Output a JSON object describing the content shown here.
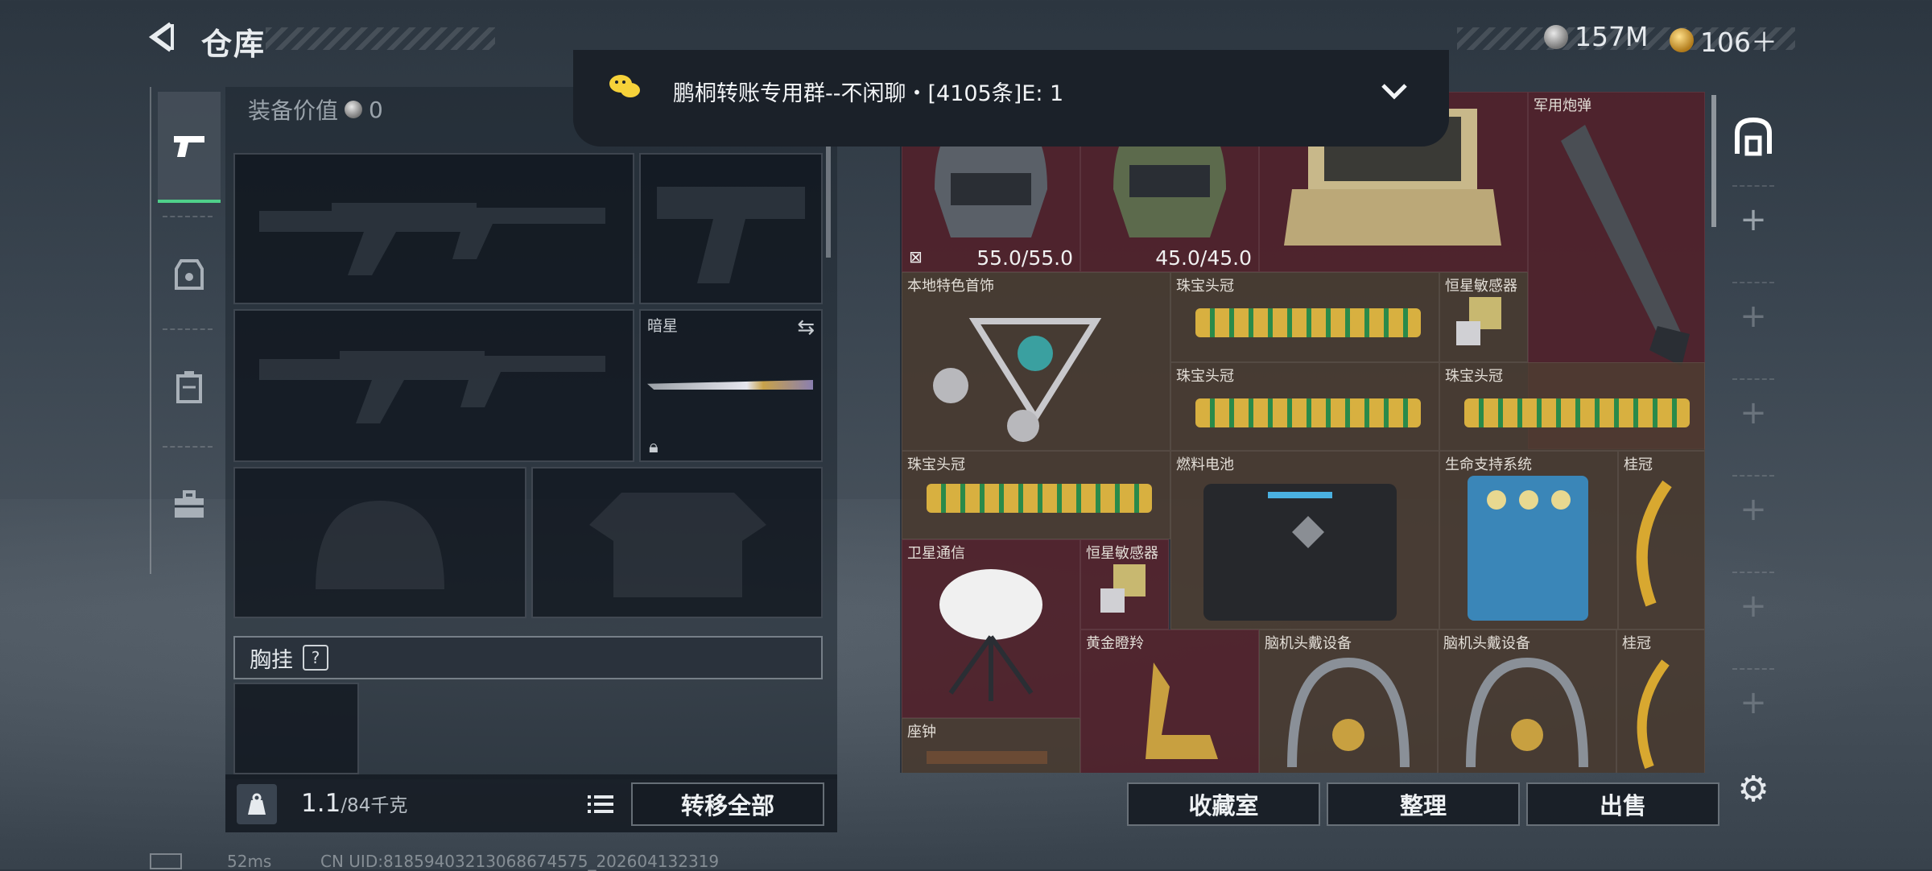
{
  "header": {
    "title": "仓库",
    "currency_silver": "157M",
    "currency_gold": "106＋"
  },
  "notification": {
    "text": "鹏桐转账专用群--不闲聊・[4105条]E: 1",
    "app_icon": "wechat-icon",
    "chevron": "chevron-down-icon"
  },
  "equipment": {
    "value_label": "装备价值",
    "value": "0",
    "melee_name": "暗星",
    "chest_label": "胸挂",
    "chest_help": "?"
  },
  "weight": {
    "current": "1.1",
    "max": "/84千克"
  },
  "buttons": {
    "transfer_all": "转移全部",
    "collection": "收藏室",
    "organize": "整理",
    "sell": "出售"
  },
  "stash": {
    "helmet1_durability": "55.0/55.0",
    "helmet2_durability": "45.0/45.0",
    "cells": [
      {
        "name": "军用炮弹"
      },
      {
        "name": "本地特色首饰"
      },
      {
        "name": "珠宝头冠"
      },
      {
        "name": "恒星敏感器"
      },
      {
        "name": "珠宝头冠"
      },
      {
        "name": "珠宝头冠"
      },
      {
        "name": "珠宝头冠"
      },
      {
        "name": "燃料电池"
      },
      {
        "name": "生命支持系统"
      },
      {
        "name": "桂冠"
      },
      {
        "name": "卫星通信"
      },
      {
        "name": "恒星敏感器"
      },
      {
        "name": "黄金瞪羚"
      },
      {
        "name": "脑机头戴设备"
      },
      {
        "name": "脑机头戴设备"
      },
      {
        "name": "桂冠"
      },
      {
        "name": "座钟"
      }
    ]
  },
  "footer": {
    "ping": "52ms",
    "uid": "CN UID:818594032130686745​75_202604132319"
  },
  "colors": {
    "active_tab": "#4fd08a",
    "rare_cell": "#58222c",
    "epic_cell": "#4e3e32"
  }
}
